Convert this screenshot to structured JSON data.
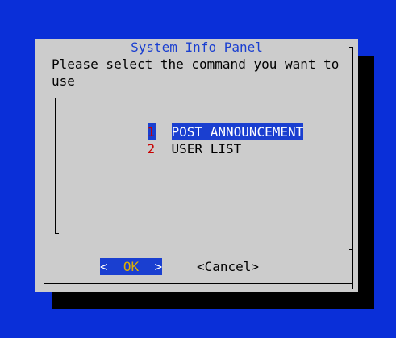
{
  "dialog": {
    "title": "System Info Panel",
    "prompt": "Please select the command you want to use"
  },
  "menu": {
    "items": [
      {
        "number": "1",
        "label": "POST ANNOUNCEMENT",
        "selected": true
      },
      {
        "number": "2",
        "label": "USER LIST",
        "selected": false
      }
    ]
  },
  "buttons": {
    "ok_left": "<  ",
    "ok_label": "OK",
    "ok_right": "  >",
    "cancel_label": "<Cancel>"
  },
  "colors": {
    "screen_background": "#0a2fd8",
    "dialog_background": "#cccccc",
    "highlight": "#1a3fd0",
    "hotkey_number": "#c80000",
    "ok_hotkey": "#e0b000"
  }
}
